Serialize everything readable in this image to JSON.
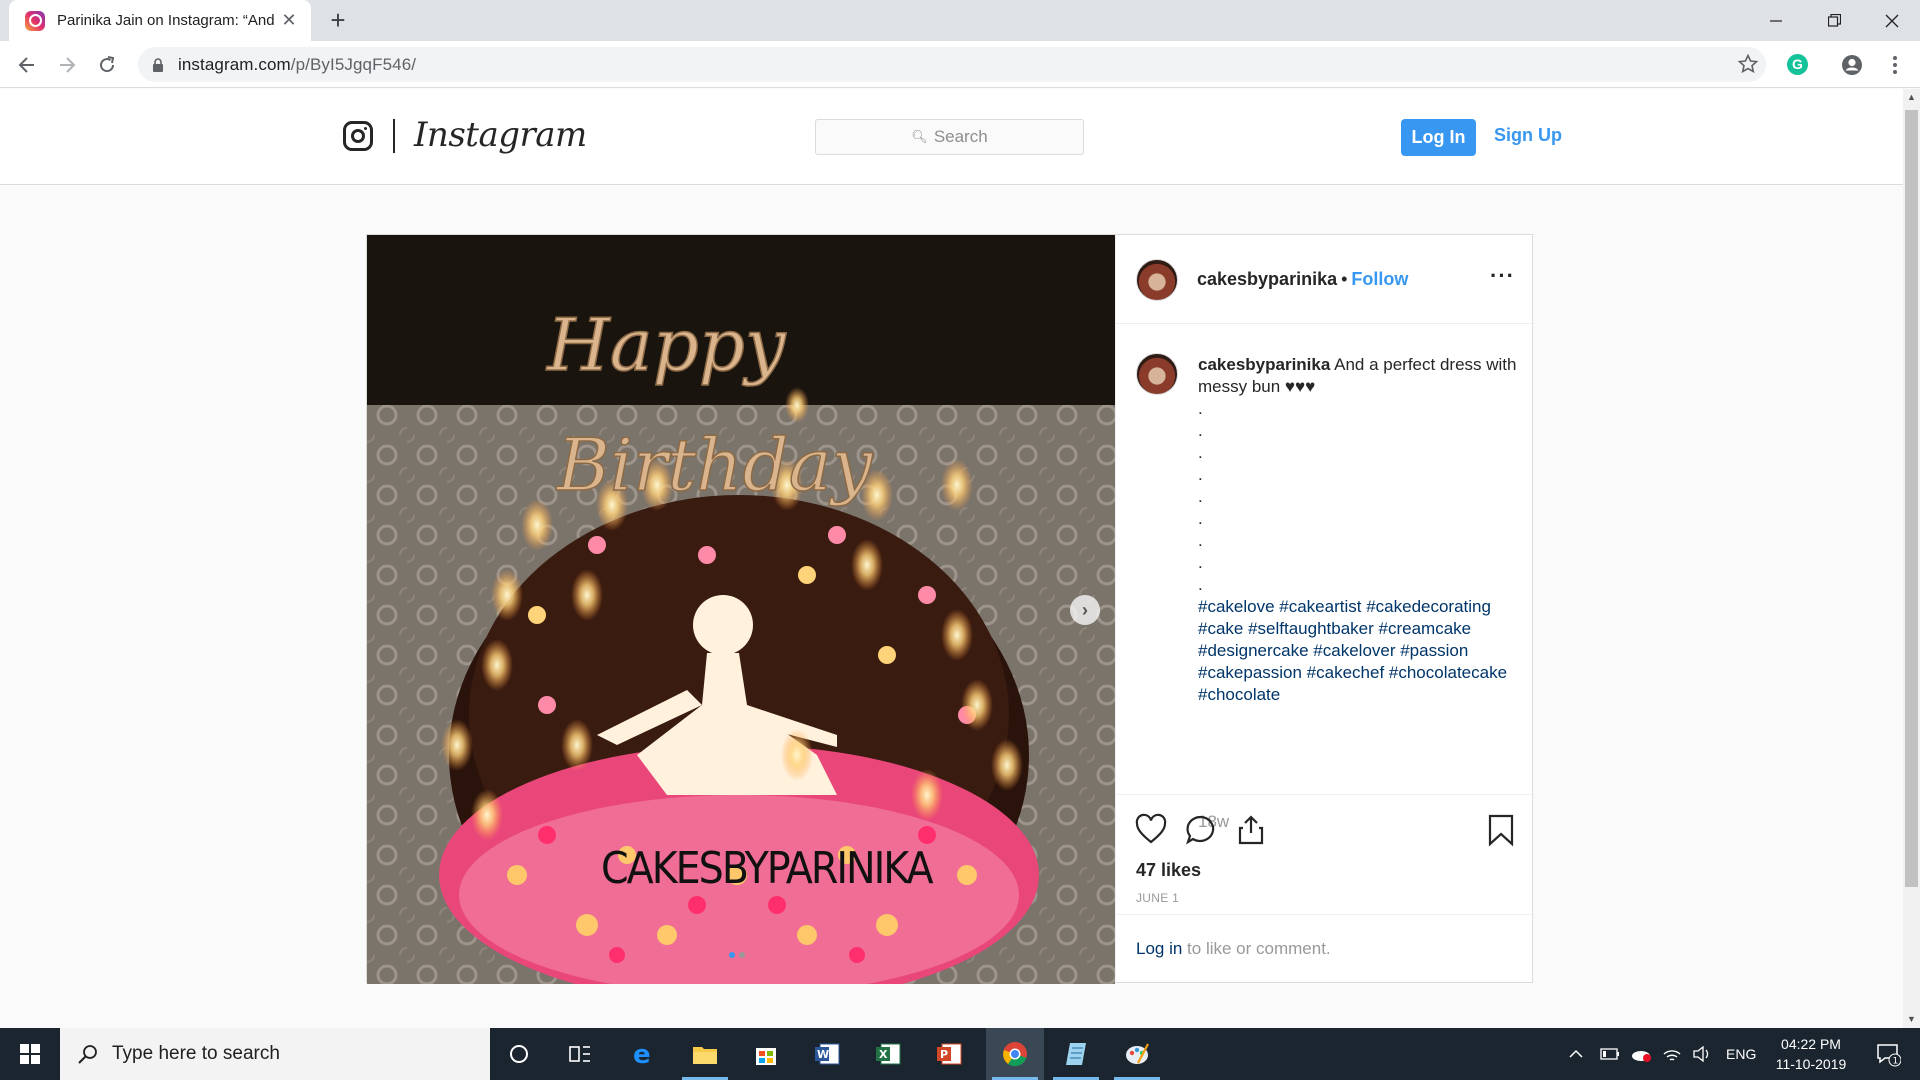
{
  "browser": {
    "tab_title": "Parinika Jain on Instagram: “And",
    "url_host": "instagram.com",
    "url_path": "/p/ByI5JgqF546/"
  },
  "ig": {
    "wordmark": "Instagram",
    "search_placeholder": "Search",
    "login_label": "Log In",
    "signup_label": "Sign Up"
  },
  "post": {
    "username": "cakesbyparinika",
    "separator": "•",
    "follow_label": "Follow",
    "more_label": "···",
    "caption_text": "And a perfect dress with messy bun ♥♥♥",
    "caption_dots": [
      ".",
      ".",
      ".",
      ".",
      ".",
      ".",
      ".",
      ".",
      "."
    ],
    "hashtags": "#cakelove #cakeartist #cakedecorating #cake #selftaughtbaker #creamcake #designercake #cakelover #passion #cakepassion #cakechef #chocolatecake #chocolate",
    "age": "18w",
    "likes": "47 likes",
    "date": "JUNE 1",
    "login_link": "Log in",
    "login_rest": " to like or comment.",
    "image_text": {
      "topper_line1": "Happy",
      "topper_line2": "Birthday",
      "watermark": "CAKESBYPARINIKA"
    },
    "carousel": {
      "count": 2,
      "active": 0
    }
  },
  "taskbar": {
    "search_placeholder": "Type here to search",
    "language": "ENG",
    "time": "04:22 PM",
    "date": "11-10-2019",
    "notification_count": "1"
  },
  "colors": {
    "ig_blue": "#3897f0",
    "hashtag": "#003569",
    "taskbar": "#1b2530"
  }
}
